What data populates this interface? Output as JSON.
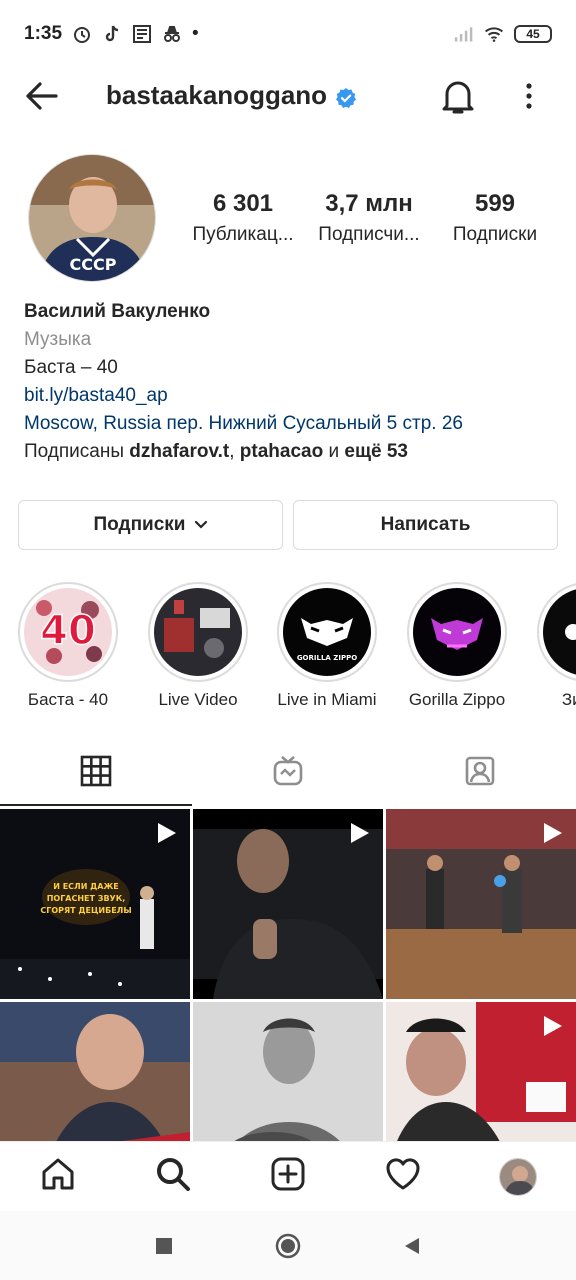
{
  "status_bar": {
    "time": "1:35",
    "left_icons": [
      "alarm-icon",
      "tiktok-icon",
      "news-icon",
      "incognito-icon"
    ],
    "dot": "•",
    "battery": "45"
  },
  "header": {
    "username": "bastaakanoggano",
    "verified": true
  },
  "stats": {
    "posts": {
      "value": "6 301",
      "label": "Публикац..."
    },
    "followers": {
      "value": "3,7 млн",
      "label": "Подписчи..."
    },
    "following": {
      "value": "599",
      "label": "Подписки"
    }
  },
  "bio": {
    "name": "Василий Вакуленко",
    "category": "Музыка",
    "description": "Баста – 40",
    "link": "bit.ly/basta40_ap",
    "address": "Moscow, Russia пер. Нижний Сусальный 5 стр. 26",
    "followed_by_prefix": "Подписаны",
    "followed_by_user1": "dzhafarov.t",
    "followed_by_sep": ",",
    "followed_by_user2": "ptahacao",
    "followed_by_and": "и",
    "followed_by_more": "ещё 53"
  },
  "buttons": {
    "following": "Подписки",
    "message": "Написать"
  },
  "highlights": [
    {
      "label": "Баста - 40",
      "badge": "40"
    },
    {
      "label": "Live Video"
    },
    {
      "label": "Live in Miami",
      "caption": "GORILLA ZIPPO"
    },
    {
      "label": "Gorilla Zippo"
    },
    {
      "label": "Зимни"
    }
  ],
  "grid_posts": [
    {
      "type": "reel",
      "text": "И ЕСЛИ ДАЖЕ ПОГАСНЕТ ЗВУК, СГОРЯТ ДЕЦИБЕЛЫ"
    },
    {
      "type": "reel"
    },
    {
      "type": "reel"
    },
    {
      "type": "photo"
    },
    {
      "type": "photo"
    },
    {
      "type": "reel"
    }
  ],
  "colors": {
    "link": "#00376b",
    "verified": "#3897f0",
    "muted": "#8e8e8e",
    "border": "#dbdbdb"
  }
}
